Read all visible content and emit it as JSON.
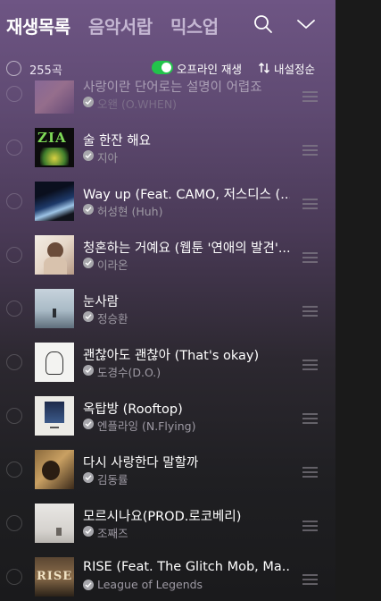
{
  "header": {
    "tabs": [
      "재생목록",
      "음악서랍",
      "믹스업"
    ],
    "search_icon": "search-icon",
    "collapse_icon": "chevron-down-icon"
  },
  "toolbar": {
    "count": "255곡",
    "offline_label": "오프라인 재생",
    "offline_enabled": true,
    "sort_label": "내설정순"
  },
  "colors": {
    "toggle_on": "#22c34b",
    "background_top": "#6e5584",
    "background_bottom": "#1a1a1c"
  },
  "songs": [
    {
      "title": "사랑이란 단어로는 설명이 어렵죠",
      "artist": "오왠 (O.WHEN)"
    },
    {
      "title": "술 한잔 해요",
      "artist": "지아"
    },
    {
      "title": "Way up (Feat. CAMO, 저스디스 (...",
      "artist": "허성현 (Huh)"
    },
    {
      "title": "청혼하는 거예요 (웹툰 '연애의 발견'...",
      "artist": "이라온"
    },
    {
      "title": "눈사람",
      "artist": "정승환"
    },
    {
      "title": "괜찮아도 괜찮아 (That's okay)",
      "artist": "도경수(D.O.)"
    },
    {
      "title": "옥탑방 (Rooftop)",
      "artist": "엔플라잉 (N.Flying)"
    },
    {
      "title": "다시 사랑한다 말할까",
      "artist": "김동률"
    },
    {
      "title": "모르시나요(PROD.로코베리)",
      "artist": "조째즈"
    },
    {
      "title": "RISE (Feat. The Glitch Mob, Ma...",
      "artist": "League of Legends"
    }
  ],
  "album_labels": [
    "ZIA",
    "RISE"
  ]
}
